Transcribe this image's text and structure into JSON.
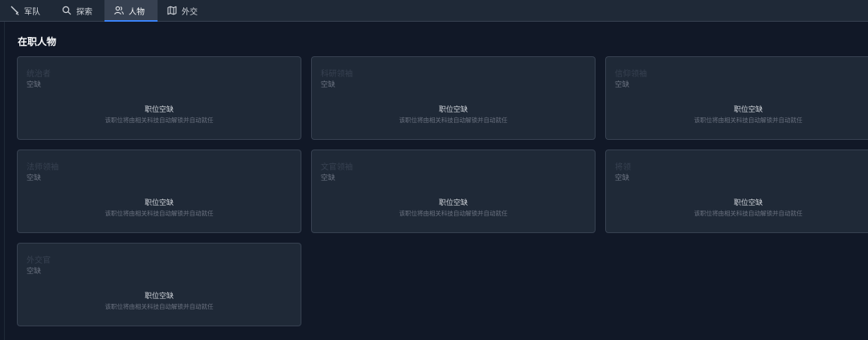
{
  "tabs": [
    {
      "label": "军队",
      "icon": "sword-icon",
      "active": false
    },
    {
      "label": "探索",
      "icon": "search-icon",
      "active": false
    },
    {
      "label": "人物",
      "icon": "users-icon",
      "active": true
    },
    {
      "label": "外交",
      "icon": "map-icon",
      "active": false
    }
  ],
  "section": {
    "title": "在职人物"
  },
  "cards": [
    {
      "role": "统治者",
      "status": "空缺",
      "vacant": "职位空缺",
      "hint": "该职位将由相关科技自动解锁并自动就任"
    },
    {
      "role": "科研领袖",
      "status": "空缺",
      "vacant": "职位空缺",
      "hint": "该职位将由相关科技自动解锁并自动就任"
    },
    {
      "role": "信仰领袖",
      "status": "空缺",
      "vacant": "职位空缺",
      "hint": "该职位将由相关科技自动解锁并自动就任"
    },
    {
      "role": "法师领袖",
      "status": "空缺",
      "vacant": "职位空缺",
      "hint": "该职位将由相关科技自动解锁并自动就任"
    },
    {
      "role": "文官领袖",
      "status": "空缺",
      "vacant": "职位空缺",
      "hint": "该职位将由相关科技自动解锁并自动就任"
    },
    {
      "role": "将领",
      "status": "空缺",
      "vacant": "职位空缺",
      "hint": "该职位将由相关科技自动解锁并自动就任"
    },
    {
      "role": "外交官",
      "status": "空缺",
      "vacant": "职位空缺",
      "hint": "该职位将由相关科技自动解锁并自动就任"
    }
  ]
}
